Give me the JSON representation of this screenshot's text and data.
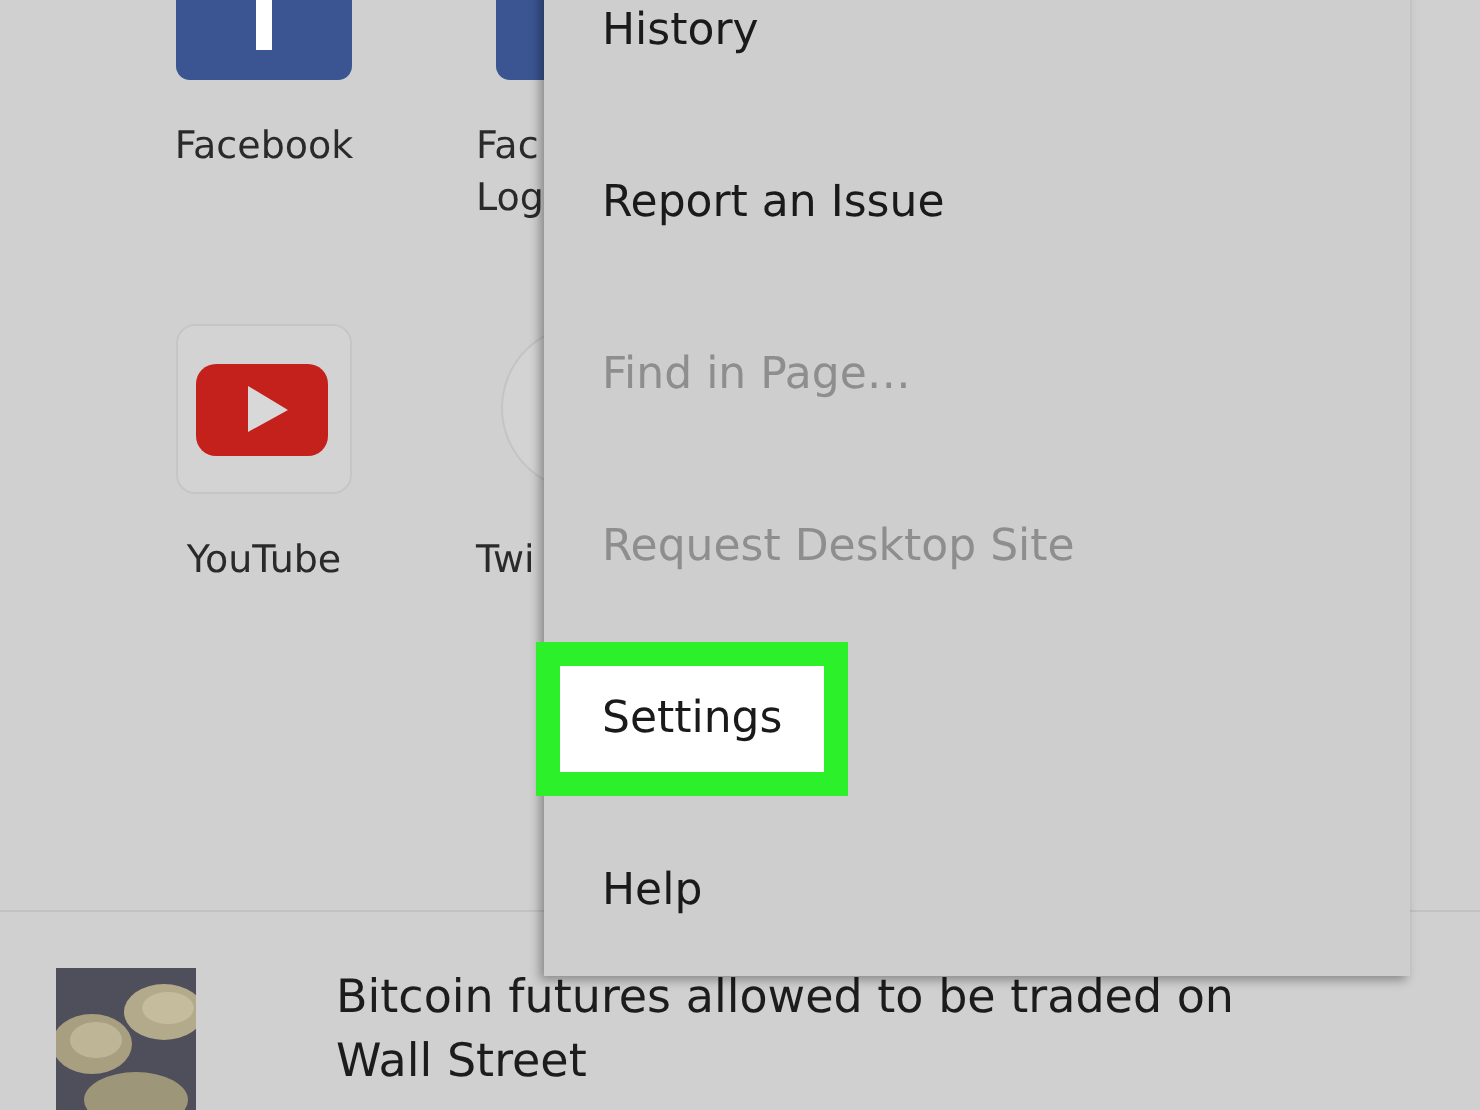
{
  "shortcuts": [
    {
      "label": "Facebook",
      "kind": "facebook"
    },
    {
      "label": "Fac\nLog",
      "kind": "facebook"
    },
    {
      "label": "YouTube",
      "kind": "youtube"
    },
    {
      "label": "Twi",
      "kind": "twitter"
    }
  ],
  "menu": {
    "items": [
      {
        "label": "History",
        "disabled": false,
        "highlighted": false
      },
      {
        "label": "Report an Issue",
        "disabled": false,
        "highlighted": false
      },
      {
        "label": "Find in Page…",
        "disabled": true,
        "highlighted": false
      },
      {
        "label": "Request Desktop Site",
        "disabled": true,
        "highlighted": false
      },
      {
        "label": "Settings",
        "disabled": false,
        "highlighted": true
      },
      {
        "label": "Help",
        "disabled": false,
        "highlighted": false
      }
    ]
  },
  "news": [
    {
      "headline": "Bitcoin futures allowed to be traded on Wall Street"
    }
  ]
}
